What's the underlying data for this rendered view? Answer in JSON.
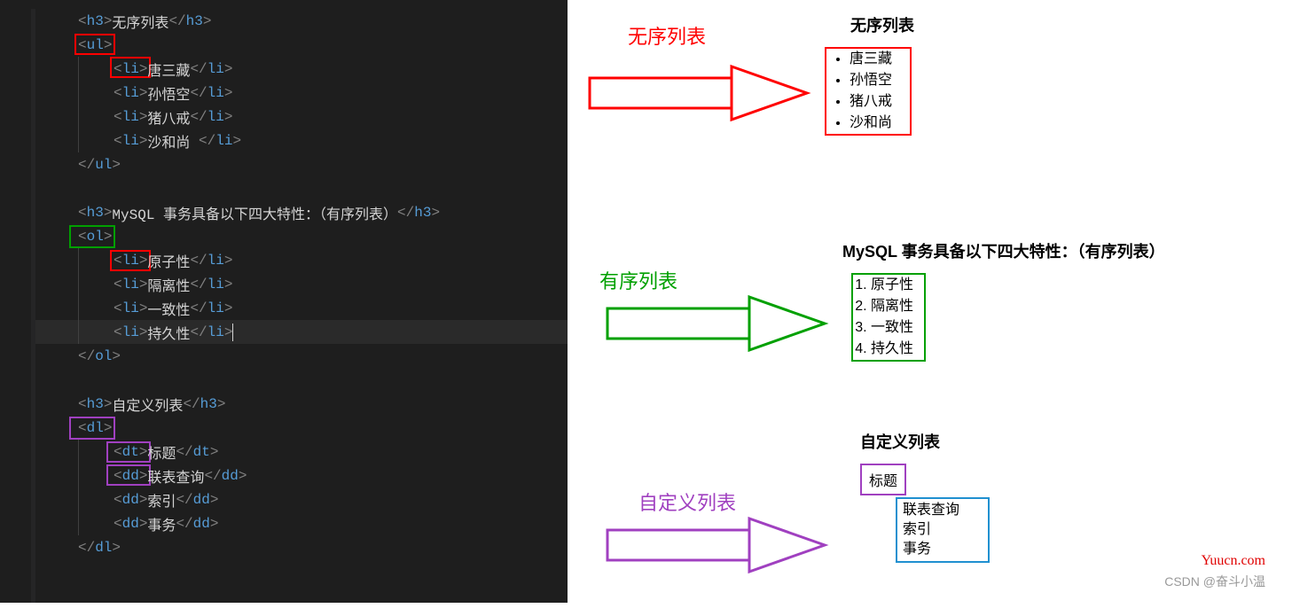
{
  "code": {
    "lines": [
      {
        "ind": 2,
        "html": "<span class='ang'>&lt;</span><span class='tag'>h3</span><span class='ang'>&gt;</span><span class='txt'>无序列表</span><span class='ang'>&lt;/</span><span class='tag'>h3</span><span class='ang'>&gt;</span>"
      },
      {
        "ind": 2,
        "html": "<span class='ang'>&lt;</span><span class='tag'>ul</span><span class='ang'>&gt;</span>"
      },
      {
        "ind": 4,
        "html": "<span class='ang'>&lt;</span><span class='tag'>li</span><span class='ang'>&gt;</span><span class='txt'>唐三藏</span><span class='ang'>&lt;/</span><span class='tag'>li</span><span class='ang'>&gt;</span>"
      },
      {
        "ind": 4,
        "html": "<span class='ang'>&lt;</span><span class='tag'>li</span><span class='ang'>&gt;</span><span class='txt'>孙悟空</span><span class='ang'>&lt;/</span><span class='tag'>li</span><span class='ang'>&gt;</span>"
      },
      {
        "ind": 4,
        "html": "<span class='ang'>&lt;</span><span class='tag'>li</span><span class='ang'>&gt;</span><span class='txt'>猪八戒</span><span class='ang'>&lt;/</span><span class='tag'>li</span><span class='ang'>&gt;</span>"
      },
      {
        "ind": 4,
        "html": "<span class='ang'>&lt;</span><span class='tag'>li</span><span class='ang'>&gt;</span><span class='txt'>沙和尚 </span><span class='ang'>&lt;/</span><span class='tag'>li</span><span class='ang'>&gt;</span>"
      },
      {
        "ind": 2,
        "html": "<span class='ang'>&lt;/</span><span class='tag'>ul</span><span class='ang'>&gt;</span>"
      },
      {
        "ind": 0,
        "html": ""
      },
      {
        "ind": 2,
        "html": "<span class='ang'>&lt;</span><span class='tag'>h3</span><span class='ang'>&gt;</span><span class='txt'>MySQL 事务具备以下四大特性：（有序列表）</span><span class='ang'>&lt;/</span><span class='tag'>h3</span><span class='ang'>&gt;</span>"
      },
      {
        "ind": 2,
        "html": "<span class='ang'>&lt;</span><span class='tag'>ol</span><span class='ang'>&gt;</span>"
      },
      {
        "ind": 4,
        "html": "<span class='ang'>&lt;</span><span class='tag'>li</span><span class='ang'>&gt;</span><span class='txt'>原子性</span><span class='ang'>&lt;/</span><span class='tag'>li</span><span class='ang'>&gt;</span>"
      },
      {
        "ind": 4,
        "html": "<span class='ang'>&lt;</span><span class='tag'>li</span><span class='ang'>&gt;</span><span class='txt'>隔离性</span><span class='ang'>&lt;/</span><span class='tag'>li</span><span class='ang'>&gt;</span>"
      },
      {
        "ind": 4,
        "html": "<span class='ang'>&lt;</span><span class='tag'>li</span><span class='ang'>&gt;</span><span class='txt'>一致性</span><span class='ang'>&lt;/</span><span class='tag'>li</span><span class='ang'>&gt;</span>"
      },
      {
        "ind": 4,
        "html": "<span class='ang'>&lt;</span><span class='tag'>li</span><span class='ang'>&gt;</span><span class='txt'>持久性</span><span class='ang'>&lt;/</span><span class='tag'>li</span><span class='ang'>&gt;</span>",
        "cursor": true,
        "highlight": true
      },
      {
        "ind": 2,
        "html": "<span class='ang'>&lt;/</span><span class='tag'>ol</span><span class='ang'>&gt;</span>"
      },
      {
        "ind": 0,
        "html": ""
      },
      {
        "ind": 2,
        "html": "<span class='ang'>&lt;</span><span class='tag'>h3</span><span class='ang'>&gt;</span><span class='txt'>自定义列表</span><span class='ang'>&lt;/</span><span class='tag'>h3</span><span class='ang'>&gt;</span>"
      },
      {
        "ind": 2,
        "html": "<span class='ang'>&lt;</span><span class='tag'>dl</span><span class='ang'>&gt;</span>"
      },
      {
        "ind": 4,
        "html": "<span class='ang'>&lt;</span><span class='tag'>dt</span><span class='ang'>&gt;</span><span class='txt'>标题</span><span class='ang'>&lt;/</span><span class='tag'>dt</span><span class='ang'>&gt;</span>"
      },
      {
        "ind": 4,
        "html": "<span class='ang'>&lt;</span><span class='tag'>dd</span><span class='ang'>&gt;</span><span class='txt'>联表查询</span><span class='ang'>&lt;/</span><span class='tag'>dd</span><span class='ang'>&gt;</span>"
      },
      {
        "ind": 4,
        "html": "<span class='ang'>&lt;</span><span class='tag'>dd</span><span class='ang'>&gt;</span><span class='txt'>索引</span><span class='ang'>&lt;/</span><span class='tag'>dd</span><span class='ang'>&gt;</span>"
      },
      {
        "ind": 4,
        "html": "<span class='ang'>&lt;</span><span class='tag'>dd</span><span class='ang'>&gt;</span><span class='txt'>事务</span><span class='ang'>&lt;/</span><span class='tag'>dd</span><span class='ang'>&gt;</span>"
      },
      {
        "ind": 2,
        "html": "<span class='ang'>&lt;/</span><span class='tag'>dl</span><span class='ang'>&gt;</span>"
      }
    ]
  },
  "labels": {
    "unordered": "无序列表",
    "ordered": "有序列表",
    "definition": "自定义列表"
  },
  "render": {
    "ul_title": "无序列表",
    "ul_items": [
      "唐三藏",
      "孙悟空",
      "猪八戒",
      "沙和尚"
    ],
    "ol_title": "MySQL 事务具备以下四大特性：（有序列表）",
    "ol_items": [
      "原子性",
      "隔离性",
      "一致性",
      "持久性"
    ],
    "dl_title": "自定义列表",
    "dl_dt": "标题",
    "dl_dd": [
      "联表查询",
      "索引",
      "事务"
    ]
  },
  "footer": {
    "csdn": "CSDN @奋斗小温",
    "yuucn": "Yuucn.com"
  },
  "colors": {
    "red": "#ff0000",
    "green": "#00a000",
    "purple": "#a040c0",
    "blue": "#2090d0"
  }
}
